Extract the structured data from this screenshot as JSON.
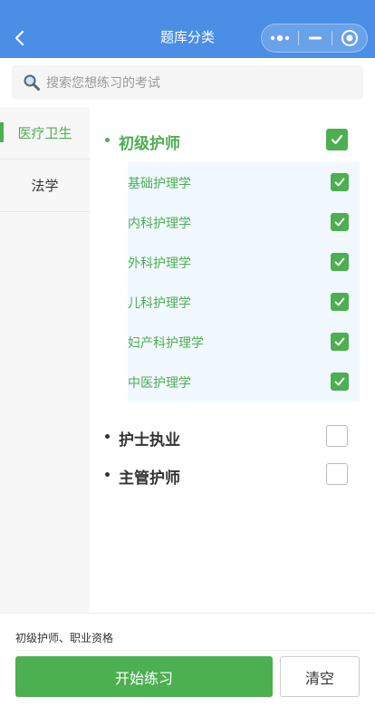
{
  "header": {
    "title": "题库分类"
  },
  "search": {
    "placeholder": "搜索您想练习的考试"
  },
  "sidebar": {
    "items": [
      {
        "label": "医疗卫生",
        "active": true
      },
      {
        "label": "法学",
        "active": false
      }
    ]
  },
  "content": {
    "groups": [
      {
        "label": "初级护师",
        "checked": true,
        "children": [
          {
            "label": "基础护理学",
            "checked": true
          },
          {
            "label": "内科护理学",
            "checked": true
          },
          {
            "label": "外科护理学",
            "checked": true
          },
          {
            "label": "儿科护理学",
            "checked": true
          },
          {
            "label": "妇产科护理学",
            "checked": true
          },
          {
            "label": "中医护理学",
            "checked": true
          }
        ]
      },
      {
        "label": "护士执业",
        "checked": false
      },
      {
        "label": "主管护师",
        "checked": false
      }
    ]
  },
  "footer": {
    "selected_text": "初级护师、职业资格",
    "start_label": "开始练习",
    "clear_label": "清空"
  },
  "colors": {
    "header_bg": "#4a8ee6",
    "accent_green": "#4caf50",
    "sub_panel_bg": "#f1f8ff"
  },
  "icons": {
    "back": "chevron-left-icon",
    "more": "more-dots-icon",
    "minimize": "minimize-icon",
    "close": "target-circle-icon",
    "search": "magnifier-icon",
    "check": "checkmark-icon"
  }
}
